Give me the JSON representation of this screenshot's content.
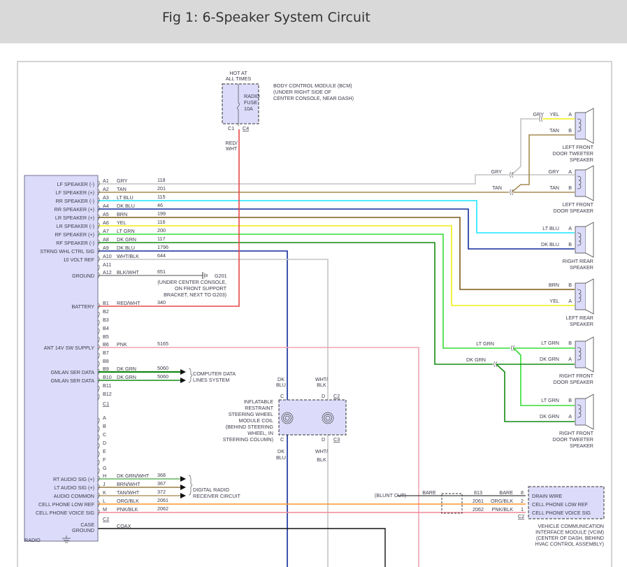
{
  "title": "Fig 1: 6-Speaker System Circuit",
  "wire_colors": {
    "GRY": "#c4c4c4",
    "TAN": "#a58a52",
    "LT BLU": "#19e6ff",
    "DK BLU": "#102a9a",
    "BRN": "#7a5a14",
    "YEL": "#f2ee10",
    "LT GRN": "#34dd34",
    "DK GRN": "#128a12",
    "WHT/BLK": "#c4c4c4",
    "BLK/WHT": "#8a8a8a",
    "RED/WHT": "#e84848",
    "PNK": "#f2a4b4",
    "DK GRN/WHT": "#64b464",
    "BRN/WHT": "#9a7c44",
    "TAN/WHT": "#b09a64",
    "ORG/BLK": "#ff9428",
    "PNK/BLK": "#f08898",
    "COAX": "#111111",
    "BARE": "#111111"
  },
  "module_fill": "#dcdcfa",
  "radio": {
    "name": "RADIO",
    "c1": "C1",
    "c2": "C2",
    "pins": [
      {
        "pin": "A1",
        "color": "GRY",
        "circuit": "118",
        "function": "LF SPEAKER (-)"
      },
      {
        "pin": "A2",
        "color": "TAN",
        "circuit": "201",
        "function": "LF SPEAKER (+)"
      },
      {
        "pin": "A3",
        "color": "LT BLU",
        "circuit": "115",
        "function": "RR SPEAKER (-)"
      },
      {
        "pin": "A4",
        "color": "DK BLU",
        "circuit": "46",
        "function": "RR SPEAKER (+)"
      },
      {
        "pin": "A5",
        "color": "BRN",
        "circuit": "199",
        "function": "LR SPEAKER (+)"
      },
      {
        "pin": "A6",
        "color": "YEL",
        "circuit": "116",
        "function": "LR SPEAKER (-)"
      },
      {
        "pin": "A7",
        "color": "LT GRN",
        "circuit": "200",
        "function": "RF SPEAKER (+)"
      },
      {
        "pin": "A8",
        "color": "DK GRN",
        "circuit": "117",
        "function": "RF SPEAKER (-)"
      },
      {
        "pin": "A9",
        "color": "DK BLU",
        "circuit": "1796",
        "function": "STRNG WHL CTRL SIG"
      },
      {
        "pin": "A10",
        "color": "WHT/BLK",
        "circuit": "644",
        "function": "10 VOLT REF"
      },
      {
        "pin": "A11",
        "color": "",
        "circuit": "",
        "function": ""
      },
      {
        "pin": "A12",
        "color": "BLK/WHT",
        "circuit": "651",
        "function": "GROUND"
      },
      {
        "pin": "B1",
        "color": "RED/WHT",
        "circuit": "340",
        "function": "BATTERY"
      },
      {
        "pin": "B2",
        "color": "",
        "circuit": "",
        "function": ""
      },
      {
        "pin": "B3",
        "color": "",
        "circuit": "",
        "function": ""
      },
      {
        "pin": "B4",
        "color": "",
        "circuit": "",
        "function": ""
      },
      {
        "pin": "B5",
        "color": "",
        "circuit": "",
        "function": ""
      },
      {
        "pin": "B6",
        "color": "PNK",
        "circuit": "5165",
        "function": "ANT 14V SW SUPPLY"
      },
      {
        "pin": "B7",
        "color": "",
        "circuit": "",
        "function": ""
      },
      {
        "pin": "B8",
        "color": "",
        "circuit": "",
        "function": ""
      },
      {
        "pin": "B9",
        "color": "DK GRN",
        "circuit": "5060",
        "function": "GMLAN SER DATA"
      },
      {
        "pin": "B10",
        "color": "DK GRN",
        "circuit": "5060",
        "function": "GMLAN SER DATA"
      },
      {
        "pin": "B11",
        "color": "",
        "circuit": "",
        "function": ""
      },
      {
        "pin": "B12",
        "color": "",
        "circuit": "",
        "function": ""
      },
      {
        "pin": "A",
        "color": "",
        "circuit": "",
        "function": ""
      },
      {
        "pin": "B",
        "color": "",
        "circuit": "",
        "function": ""
      },
      {
        "pin": "C",
        "color": "",
        "circuit": "",
        "function": ""
      },
      {
        "pin": "D",
        "color": "",
        "circuit": "",
        "function": ""
      },
      {
        "pin": "E",
        "color": "",
        "circuit": "",
        "function": ""
      },
      {
        "pin": "F",
        "color": "",
        "circuit": "",
        "function": ""
      },
      {
        "pin": "G",
        "color": "",
        "circuit": "",
        "function": ""
      },
      {
        "pin": "H",
        "color": "DK GRN/WHT",
        "circuit": "368",
        "function": "RT AUDIO SIG (+)"
      },
      {
        "pin": "J",
        "color": "BRN/WHT",
        "circuit": "367",
        "function": "LT AUDIO SIG (+)"
      },
      {
        "pin": "K",
        "color": "TAN/WHT",
        "circuit": "372",
        "function": "AUDIO COMMON"
      },
      {
        "pin": "L",
        "color": "ORG/BLK",
        "circuit": "2061",
        "function": "CELL PHONE LOW REF"
      },
      {
        "pin": "M",
        "color": "PNK/BLK",
        "circuit": "2062",
        "function": "CELL PHONE VOICE SIG"
      }
    ],
    "coax": {
      "color": "COAX",
      "function_1": "CASE",
      "function_2": "GROUND"
    }
  },
  "bcm": {
    "hot": [
      "HOT AT",
      "ALL TIMES"
    ],
    "fuse": [
      "RADIO",
      "FUSE",
      "10A"
    ],
    "desc": [
      "BODY CONTROL MODULE (BCM)",
      "(UNDER RIGHT SIDE OF",
      "CENTER CONSOLE, NEAR DASH)"
    ],
    "c1": "C1",
    "c4": "C4",
    "wire": [
      "RED/",
      "WHT"
    ]
  },
  "ground": {
    "id": "G201",
    "desc": [
      "(UNDER CENTER CONSOLE,",
      "ON FRONT SUPPORT",
      "BRACKET, NEXT TO G203)"
    ]
  },
  "computer_data": [
    "COMPUTER DATA",
    "LINES SYSTEM"
  ],
  "digital_radio": [
    "DIGITAL RADIO",
    "RECEIVER CIRCUIT"
  ],
  "steering": {
    "desc": [
      "INFLATABLE",
      "RESTRAINT",
      "STEERING WHEEL",
      "MODULE COIL",
      "(BEHIND STEERING",
      "WHEEL, IN",
      "STEERING COLUMN)"
    ],
    "top_left": [
      "DK",
      "BLU"
    ],
    "top_right": [
      "WHT/",
      "BLK"
    ],
    "bot_left": [
      "DK",
      "BLU"
    ],
    "bot_right": [
      "WHT/",
      "BLK"
    ],
    "pin_c": "C",
    "pin_d": "D",
    "c2": "C2",
    "c3": "C3"
  },
  "speakers": [
    {
      "name": [
        "LEFT FRONT",
        "DOOR TWEETER",
        "SPEAKER"
      ],
      "pins": [
        {
          "pin": "A",
          "color": "YEL"
        },
        {
          "pin": "B",
          "color": "TAN"
        }
      ],
      "in_label": "GRY"
    },
    {
      "name": [
        "LEFT FRONT",
        "DOOR SPEAKER"
      ],
      "pins": [
        {
          "pin": "A",
          "color": "GRY"
        },
        {
          "pin": "B",
          "color": "TAN"
        }
      ],
      "in_labels": [
        "GRY",
        "TAN"
      ]
    },
    {
      "name": [
        "RIGHT REAR",
        "SPEAKER"
      ],
      "pins": [
        {
          "pin": "A",
          "color": "LT BLU"
        },
        {
          "pin": "B",
          "color": "DK BLU"
        }
      ]
    },
    {
      "name": [
        "LEFT REAR",
        "SPEAKER"
      ],
      "pins": [
        {
          "pin": "B",
          "color": "BRN"
        },
        {
          "pin": "A",
          "color": "YEL"
        }
      ]
    },
    {
      "name": [
        "RIGHT FRONT",
        "DOOR SPEAKER"
      ],
      "pins": [
        {
          "pin": "B",
          "color": "LT GRN"
        },
        {
          "pin": "A",
          "color": "DK GRN"
        }
      ],
      "in_labels": [
        "LT GRN",
        "DK GRN"
      ]
    },
    {
      "name": [
        "RIGHT FRONT",
        "DOOR TWEETER",
        "SPEAKER"
      ],
      "pins": [
        {
          "pin": "B",
          "color": "LT GRN"
        },
        {
          "pin": "A",
          "color": "DK GRN"
        }
      ]
    }
  ],
  "vcim": {
    "blunt": "(BLUNT CUT)",
    "bare_left": "BARE",
    "drain_circuit": "813",
    "bare_right": "BARE",
    "pins": [
      {
        "pin": "8",
        "circuit": "813",
        "color": "BARE",
        "function": "DRAIN WIRE"
      },
      {
        "pin": "2",
        "circuit": "2061",
        "color": "ORG/BLK",
        "function": "CELL PHONE LOW REF"
      },
      {
        "pin": "1",
        "circuit": "2062",
        "color": "PNK/BLK",
        "function": "CELL PHONE VOICE SIG"
      }
    ],
    "conn": "C2",
    "desc": [
      "VEHICLE COMMUNICATION",
      "INTERFACE MODULE (VCIM)",
      "(CENTER OF DASH, BEHIND",
      "HVAC CONTROL ASSEMBLY)"
    ]
  }
}
